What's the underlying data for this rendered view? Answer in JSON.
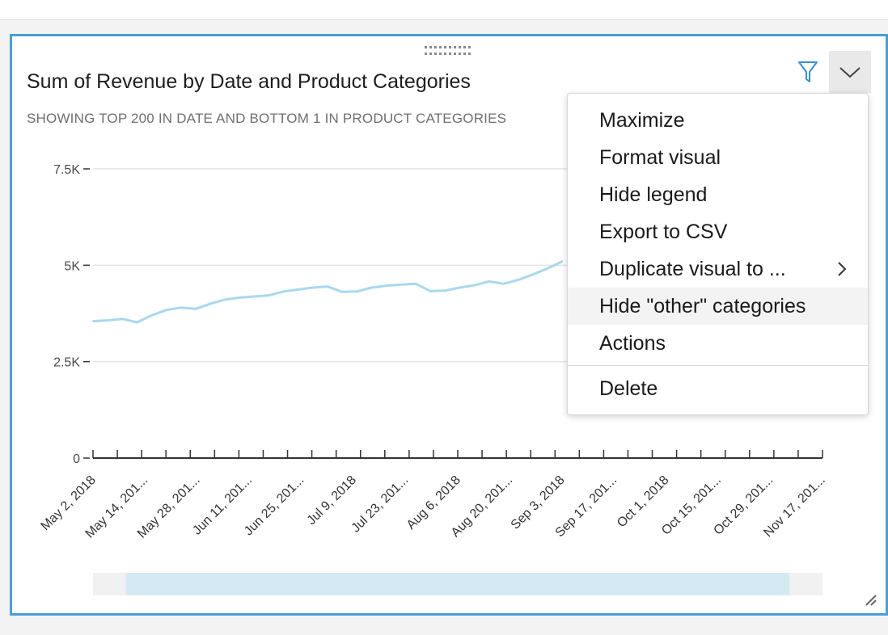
{
  "visual": {
    "title": "Sum of Revenue by Date and Product Categories",
    "subtitle": "SHOWING TOP 200 IN DATE AND BOTTOM 1 IN PRODUCT CATEGORIES",
    "icons": [
      "drag-handle-icon",
      "filter-icon",
      "chevron-down-icon",
      "resize-grip-icon"
    ],
    "accent_color": "#4a9fd6"
  },
  "menu": {
    "items": [
      {
        "label": "Maximize"
      },
      {
        "label": "Format visual"
      },
      {
        "label": "Hide legend"
      },
      {
        "label": "Export to CSV"
      },
      {
        "label": "Duplicate visual to ...",
        "has_submenu": true
      },
      {
        "label": "Hide \"other\" categories",
        "highlighted": true
      },
      {
        "label": "Actions"
      },
      {
        "label": "Delete"
      }
    ]
  },
  "chart_data": {
    "type": "line",
    "x_tick_labels": [
      "May 2, 2018",
      "May 14, 201...",
      "May 28, 201...",
      "Jun 11, 201...",
      "Jun 25, 201...",
      "Jul 9, 2018",
      "Jul 23, 201...",
      "Aug 6, 2018",
      "Aug 20, 201...",
      "Sep 3, 2018",
      "Sep 17, 201...",
      "Oct 1, 2018",
      "Oct 15, 201...",
      "Oct 29, 201...",
      "Nov 17, 201..."
    ],
    "y_tick_labels": [
      "0",
      "2.5K",
      "5K",
      "7.5K"
    ],
    "y_ticks": [
      0,
      2500,
      5000,
      7500
    ],
    "ylim": [
      0,
      7500
    ],
    "grid": true,
    "series_color": "#a9d8ee",
    "scrollbar_window": [
      0.045,
      0.955
    ],
    "series": [
      {
        "x": [
          "2018-05-02",
          "2018-05-06",
          "2018-05-10",
          "2018-05-14",
          "2018-05-18",
          "2018-05-22",
          "2018-05-26",
          "2018-05-30",
          "2018-06-03",
          "2018-06-07",
          "2018-06-11",
          "2018-06-15",
          "2018-06-19",
          "2018-06-23",
          "2018-06-27",
          "2018-07-01",
          "2018-07-05",
          "2018-07-09",
          "2018-07-13",
          "2018-07-17",
          "2018-07-21",
          "2018-07-25",
          "2018-07-29",
          "2018-08-02",
          "2018-08-06",
          "2018-08-10",
          "2018-08-14",
          "2018-08-18",
          "2018-08-22",
          "2018-08-26",
          "2018-08-30",
          "2018-09-03",
          "2018-09-07"
        ],
        "values": [
          3550,
          3570,
          3610,
          3520,
          3700,
          3840,
          3900,
          3870,
          4000,
          4110,
          4160,
          4190,
          4220,
          4320,
          4370,
          4420,
          4450,
          4310,
          4320,
          4420,
          4470,
          4500,
          4520,
          4330,
          4340,
          4420,
          4480,
          4580,
          4520,
          4620,
          4760,
          4920,
          5100
        ]
      }
    ]
  }
}
